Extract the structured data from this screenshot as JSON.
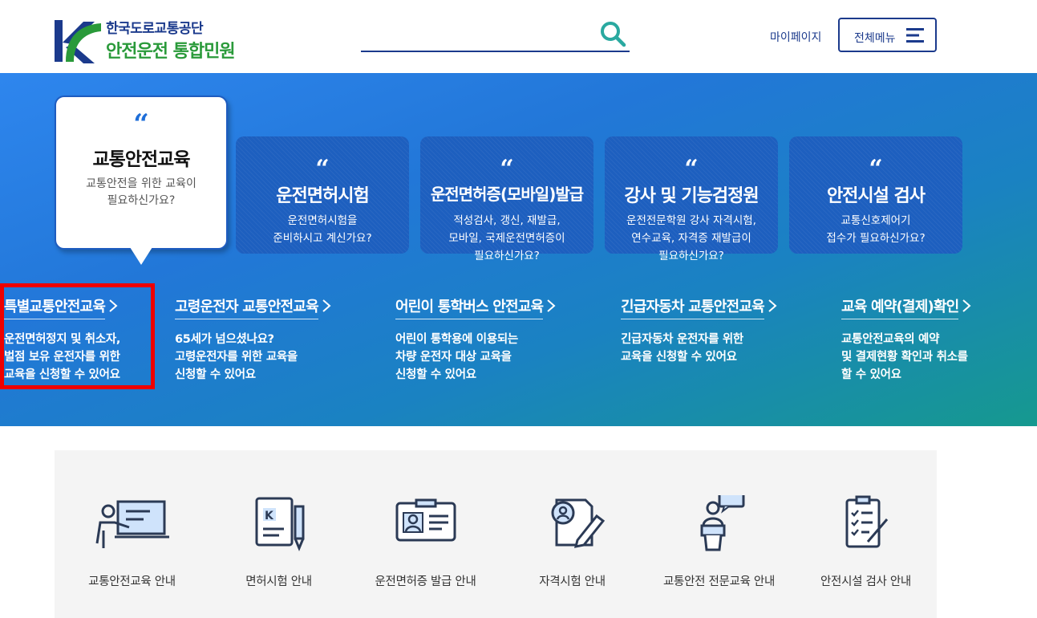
{
  "header": {
    "org_name": "한국도로교통공단",
    "site_name": "안전운전 통합민원",
    "search_placeholder": "",
    "mypage_label": "마이페이지",
    "menu_label": "전체메뉴"
  },
  "hero": {
    "featured": {
      "quote": "“",
      "title": "교통안전교육",
      "desc": "교통안전을 위한 교육이\n필요하신가요?"
    },
    "cards": [
      {
        "quote": "“",
        "title": "운전면허시험",
        "desc": "운전면허시험을\n준비하시고 계신가요?"
      },
      {
        "quote": "“",
        "title": "운전면허증(모바일)발급",
        "desc": "적성검사, 갱신, 재발급,\n모바일, 국제운전면허증이\n필요하신가요?"
      },
      {
        "quote": "“",
        "title": "강사 및 기능검정원",
        "desc": "운전전문학원 강사 자격시험,\n연수교육, 자격증 재발급이\n필요하신가요?"
      },
      {
        "quote": "“",
        "title": "안전시설 검사",
        "desc": "교통신호제어기\n접수가 필요하신가요?"
      }
    ],
    "links": [
      {
        "title": "특별교통안전교육",
        "desc": "운전면허정지 및 취소자,\n벌점 보유 운전자를 위한\n교육을 신청할 수 있어요"
      },
      {
        "title": "고령운전자 교통안전교육",
        "desc": "65세가 넘으셨나요?\n고령운전자를 위한 교육을\n신청할 수 있어요"
      },
      {
        "title": "어린이 통학버스 안전교육",
        "desc": "어린이 통학용에 이용되는\n차량 운전자 대상 교육을\n신청할 수 있어요"
      },
      {
        "title": "긴급자동차 교통안전교육",
        "desc": "긴급자동차 운전자를 위한\n교육을 신청할 수 있어요"
      },
      {
        "title": "교육 예약(결제)확인",
        "desc": "교통안전교육의 예약\n및 결제현황 확인과 취소를\n할 수 있어요"
      }
    ]
  },
  "services": [
    {
      "label": "교통안전교육 안내",
      "icon": "lecture-icon"
    },
    {
      "label": "면허시험 안내",
      "icon": "license-book-icon"
    },
    {
      "label": "운전면허증 발급 안내",
      "icon": "id-card-icon"
    },
    {
      "label": "자격시험 안내",
      "icon": "exam-document-icon"
    },
    {
      "label": "교통안전 전문교육 안내",
      "icon": "speaker-podium-icon"
    },
    {
      "label": "안전시설 검사 안내",
      "icon": "checklist-icon"
    }
  ],
  "colors": {
    "brand_navy": "#1b3a8c",
    "brand_green": "#2a9a3a",
    "hero_blue": "#2e86ee",
    "hero_teal": "#16998f",
    "card_blue": "#1d5fbf",
    "highlight_red": "#ee0000"
  }
}
